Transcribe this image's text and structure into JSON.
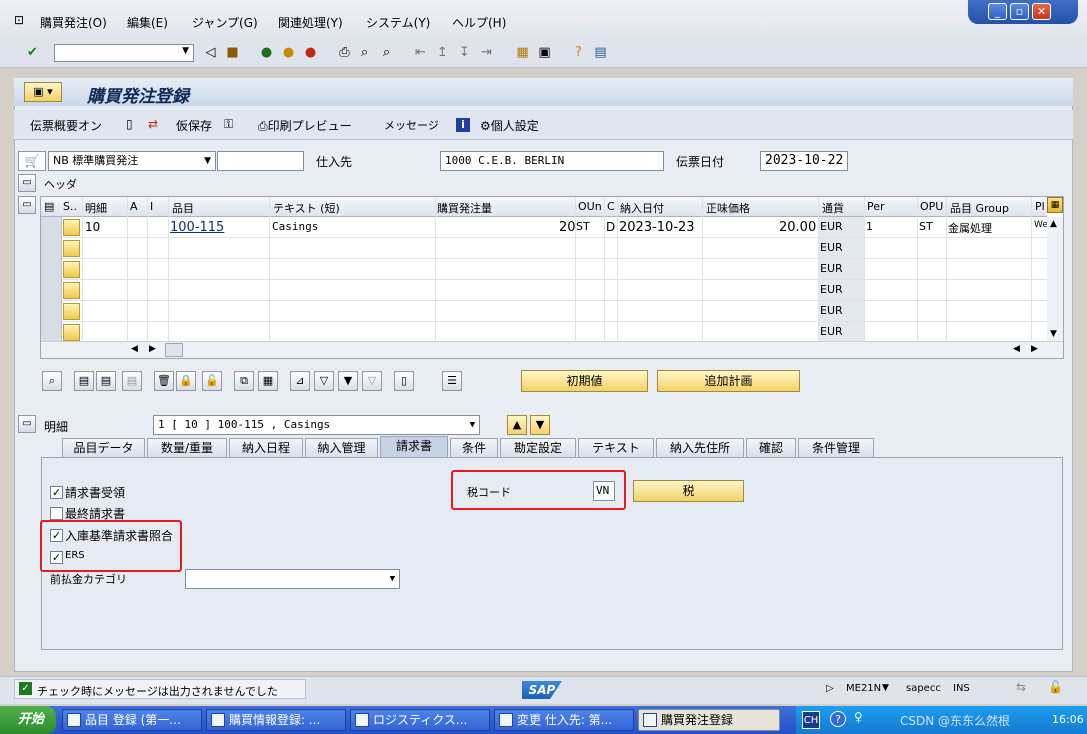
{
  "menu": {
    "items": [
      "購買発注(O)",
      "編集(E)",
      "ジャンプ(G)",
      "関連処理(Y)",
      "システム(Y)",
      "ヘルプ(H)"
    ]
  },
  "title": "購買発注登録",
  "app_toolbar": {
    "toggle": "伝票概要オン",
    "hold": "仮保存",
    "print_preview": "印刷プレビュー",
    "messages": "メッセージ",
    "personal": "個人設定"
  },
  "header": {
    "doc_type": "NB 標準購買発注",
    "vendor_label": "仕入先",
    "vendor": "1000 C.E.B. BERLIN",
    "date_label": "伝票日付",
    "date": "2023-10-22",
    "header_label": "ヘッダ"
  },
  "grid": {
    "columns": [
      "S..",
      "明細",
      "A",
      "I",
      "品目",
      "テキスト (短)",
      "購買発注量",
      "OUn",
      "C",
      "納入日付",
      "正味価格",
      "通貨",
      "Per",
      "OPU",
      "品目 Group",
      "Pl"
    ],
    "row1": {
      "item": "10",
      "material": "100-115",
      "text": "Casings",
      "qty": "20",
      "oun": "ST",
      "c": "D",
      "delivery": "2023-10-23",
      "price": "20.00",
      "currency": "EUR",
      "per": "1",
      "opu": "ST",
      "group": "金属処理",
      "pl": "We"
    },
    "empty_currency": "EUR"
  },
  "buttons": {
    "default_values": "初期値",
    "add_planning": "追加計画",
    "tax": "税"
  },
  "item_detail": {
    "label": "明細",
    "selected": "1 [ 10 ] 100-115 , Casings"
  },
  "tabs": [
    "品目データ",
    "数量/重量",
    "納入日程",
    "納入管理",
    "請求書",
    "条件",
    "勘定設定",
    "テキスト",
    "納入先住所",
    "確認",
    "条件管理"
  ],
  "invoice_tab": {
    "inv_receipt": "請求書受領",
    "final_invoice": "最終請求書",
    "gr_based_iv": "入庫基準請求書照合",
    "ers": "ERS",
    "tax_code_label": "税コード",
    "tax_code": "VN",
    "downpay_label": "前払金カテゴリ"
  },
  "status": {
    "message": "チェック時にメッセージは出力されませんでした",
    "logo": "SAP",
    "tcode": "ME21N",
    "server": "sapecc",
    "mode": "INS"
  },
  "taskbar": {
    "start": "开始",
    "tasks": [
      "品目 登録 (第一...",
      "購買情報登録: ...",
      "ロジスティクス...",
      "変更 仕入先: 第...",
      "購買発注登録"
    ],
    "lang": "CH",
    "watermark": "CSDN @东东么然根",
    "time": "16:06"
  }
}
